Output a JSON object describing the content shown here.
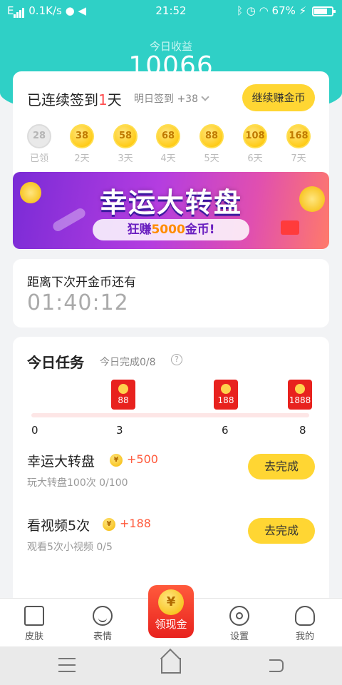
{
  "status_bar": {
    "network": "0.1K/s",
    "time": "21:52",
    "battery": "67%",
    "icons": [
      "signal-icon",
      "message-icon",
      "mute-icon",
      "bluetooth-icon",
      "alarm-icon",
      "wifi-icon",
      "charging-icon",
      "battery-icon"
    ]
  },
  "header": {
    "label": "今日收益",
    "total": "10066"
  },
  "signin": {
    "title_prefix": "已连续签到",
    "days": "1",
    "title_suffix": "天",
    "tomorrow": "明日签到 +38",
    "earn_button": "继续赚金币",
    "coins": [
      {
        "value": "28",
        "label": "已领",
        "claimed": true
      },
      {
        "value": "38",
        "label": "2天",
        "claimed": false
      },
      {
        "value": "58",
        "label": "3天",
        "claimed": false
      },
      {
        "value": "68",
        "label": "4天",
        "claimed": false
      },
      {
        "value": "88",
        "label": "5天",
        "claimed": false
      },
      {
        "value": "108",
        "label": "6天",
        "claimed": false
      },
      {
        "value": "168",
        "label": "7天",
        "claimed": false
      }
    ]
  },
  "banner": {
    "title": "幸运大转盘",
    "sub_prefix": "狂赚",
    "sub_amount": "5000",
    "sub_suffix": "金币!"
  },
  "countdown": {
    "label": "距离下次开金币还有",
    "time": "01:40:12"
  },
  "tasks": {
    "title": "今日任务",
    "progress": "今日完成0/8",
    "help_icon": "?",
    "rewards": [
      "88",
      "188",
      "1888"
    ],
    "milestones": [
      "0",
      "3",
      "6",
      "8"
    ],
    "items": [
      {
        "name": "幸运大转盘",
        "reward": "+500",
        "desc": "玩大转盘100次 0/100",
        "button": "去完成"
      },
      {
        "name": "看视频5次",
        "reward": "+188",
        "desc": "观看5次小视频 0/5",
        "button": "去完成"
      }
    ]
  },
  "tabbar": {
    "tabs": [
      {
        "label": "皮肤",
        "icon": "shirt-icon"
      },
      {
        "label": "表情",
        "icon": "smiley-icon"
      },
      {
        "label": "设置",
        "icon": "settings-icon"
      },
      {
        "label": "我的",
        "icon": "profile-icon"
      }
    ],
    "cash": {
      "label": "领现金",
      "symbol": "¥"
    }
  },
  "colors": {
    "accent": "#2fd0c6",
    "button": "#ffd633",
    "reward": "#ff5a3c",
    "red": "#e8221e"
  }
}
